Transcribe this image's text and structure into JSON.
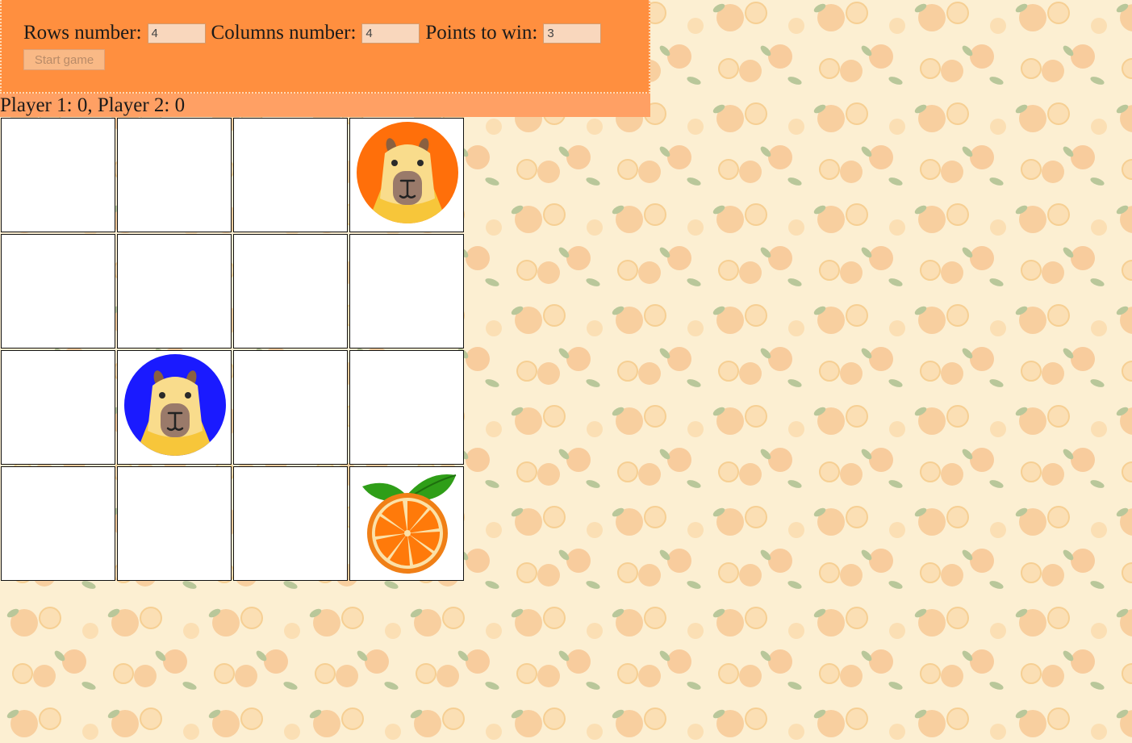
{
  "settings": {
    "rows_label": "Rows number:",
    "rows_value": "4",
    "columns_label": "Columns number:",
    "columns_value": "4",
    "points_label": "Points to win:",
    "points_value": "3",
    "start_label": "Start game"
  },
  "score": {
    "text": "Player 1: 0, Player 2: 0"
  },
  "board": {
    "rows": 4,
    "columns": 4,
    "cells": [
      [
        "",
        "",
        "",
        "capybara-orange"
      ],
      [
        "",
        "",
        "",
        ""
      ],
      [
        "",
        "capybara-blue",
        "",
        ""
      ],
      [
        "",
        "",
        "",
        "orange"
      ]
    ]
  },
  "colors": {
    "panel": "#ff8f3f",
    "score_bar": "#ffa064",
    "background": "#fcefd2",
    "capybara_orange_bg": "#ff6f0a",
    "capybara_blue_bg": "#1a1aff"
  }
}
